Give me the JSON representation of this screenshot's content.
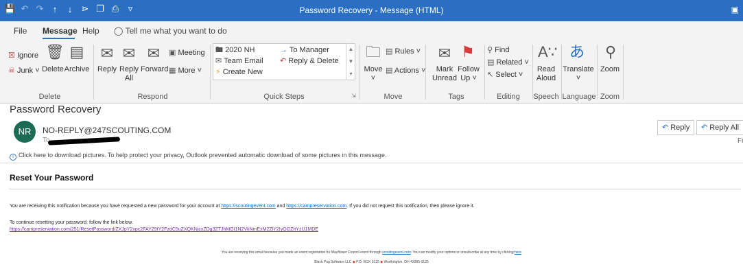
{
  "window": {
    "title": "Password Recovery  -  Message (HTML)"
  },
  "tabs": {
    "file": "File",
    "message": "Message",
    "help": "Help",
    "tell_me": "Tell me what you want to do"
  },
  "ribbon": {
    "delete_group": {
      "label": "Delete",
      "ignore": "Ignore",
      "junk": "Junk",
      "delete": "Delete",
      "archive": "Archive"
    },
    "respond_group": {
      "label": "Respond",
      "reply": "Reply",
      "reply_all_1": "Reply",
      "reply_all_2": "All",
      "forward": "Forward",
      "meeting": "Meeting",
      "more": "More"
    },
    "quick_steps_group": {
      "label": "Quick Steps",
      "item1": "2020 NH",
      "item2": "Team Email",
      "item3": "Create New",
      "item4": "To Manager",
      "item5": "Reply & Delete"
    },
    "move_group": {
      "label": "Move",
      "move": "Move",
      "rules": "Rules",
      "actions": "Actions"
    },
    "tags_group": {
      "label": "Tags",
      "mark_unread_1": "Mark",
      "mark_unread_2": "Unread",
      "follow_up_1": "Follow",
      "follow_up_2": "Up"
    },
    "editing_group": {
      "label": "Editing",
      "find": "Find",
      "related": "Related",
      "select": "Select"
    },
    "speech_group": {
      "label": "Speech",
      "read_aloud_1": "Read",
      "read_aloud_2": "Aloud"
    },
    "language_group": {
      "label": "Language",
      "translate": "Translate"
    },
    "zoom_group": {
      "label": "Zoom",
      "zoom": "Zoom"
    }
  },
  "message": {
    "subject": "Password Recovery",
    "avatar_initials": "NR",
    "sender": "NO-REPLY@247SCOUTING.COM",
    "to_prefix": "To",
    "reply": "Reply",
    "reply_all": "Reply All",
    "edge_char": "Fr",
    "info_bar": "Click here to download pictures. To help protect your privacy, Outlook prevented automatic download of some pictures in this message."
  },
  "body": {
    "heading": "Reset Your Password",
    "p1_start": "You are receiving this notification because you have requested a new password for your account at ",
    "p1_link1": "https://scoutingevent.com",
    "p1_and": " and ",
    "p1_link2": "https://campreservation.com",
    "p1_end": ". If you did not request this notification, then please ignore it.",
    "p2": "To continue resetting your password, follow the link below.",
    "reset_link": "https://campreservation.com/251/ResetPassword/ZXJpY2xpc2FAY29tY2FzdC5uZXQKNjcxZDg3ZTJhMGI1N2VkNmExM2ZlY2IyOGZhYzU1MDE",
    "footer_start": "You are receiving this email because you made an event registration for Mayflower Council event through ",
    "footer_link1": "scoutingevent.com",
    "footer_mid": ". You can modify your options or unsubscribe at any time by clicking ",
    "footer_link2": "here",
    "footer_company": "Black Pug Software LLC",
    "footer_po": "P.O. BOX 0125",
    "footer_city": "Worthington, OH 43085-0125"
  }
}
